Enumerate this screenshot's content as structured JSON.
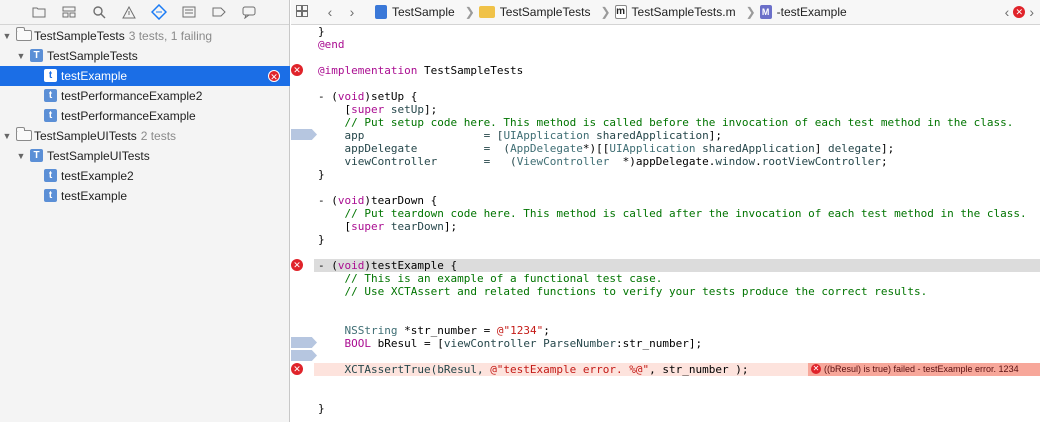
{
  "navigator": {
    "toolbar_icons": [
      "folder-icon",
      "hierarchy-icon",
      "search-icon",
      "warning-icon",
      "test-diamond-icon",
      "breakpoint-icon",
      "list-icon",
      "comment-icon"
    ],
    "items": [
      {
        "label": "TestSampleTests",
        "sub": "3 tests, 1 failing"
      },
      {
        "label": "TestSampleTests"
      },
      {
        "label": "testExample"
      },
      {
        "label": "testPerformanceExample2"
      },
      {
        "label": "testPerformanceExample"
      },
      {
        "label": "TestSampleUITests",
        "sub": "2 tests"
      },
      {
        "label": "TestSampleUITests"
      },
      {
        "label": "testExample2"
      },
      {
        "label": "testExample"
      }
    ],
    "t_glyph": "T",
    "t_small_glyph": "t",
    "error_glyph": "✕"
  },
  "jumpbar": {
    "project": "TestSample",
    "group": "TestSampleTests",
    "file": "TestSampleTests.m",
    "m_glyph": "m",
    "M_glyph": "M",
    "method": "-testExample"
  },
  "code": {
    "l1": "}",
    "l2": "@end",
    "l3_kw": "@implementation",
    "l3_name": " TestSampleTests",
    "l4_a": "- (",
    "l4_kw": "void",
    "l4_b": ")setUp {",
    "l5_a": "    [",
    "l5_kw": "super",
    "l5_m": " setUp",
    "l5_b": "];",
    "l6": "    // Put setup code here. This method is called before the invocation of each test method in the class.",
    "l7_a": "    app                  = [",
    "l7_cls": "UIApplication",
    "l7_m": " sharedApplication",
    "l7_b": "];",
    "l8_a": "    appDelegate          =  (",
    "l8_cls": "AppDelegate",
    "l8_b": "*)[[",
    "l8_cls2": "UIApplication",
    "l8_m": " sharedApplication",
    "l8_c": "] ",
    "l8_m2": "delegate",
    "l8_d": "];",
    "l9_a": "    viewController       =   (",
    "l9_cls": "ViewController",
    "l9_b": "  *)appDelegate.",
    "l9_m": "window",
    "l9_c": ".",
    "l9_m2": "rootViewController",
    "l9_d": ";",
    "l10": "}",
    "l11_a": "- (",
    "l11_kw": "void",
    "l11_b": ")tearDown {",
    "l12": "    // Put teardown code here. This method is called after the invocation of each test method in the class.",
    "l13_a": "    [",
    "l13_kw": "super",
    "l13_m": " tearDown",
    "l13_b": "];",
    "l14": "}",
    "l15_a": "- (",
    "l15_kw": "void",
    "l15_b": ")testExample {",
    "l16": "    // This is an example of a functional test case.",
    "l17": "    // Use XCTAssert and related functions to verify your tests produce the correct results.",
    "l18_cls": "    NSString",
    "l18_a": " *str_number = ",
    "l18_st": "@\"1234\"",
    "l18_b": ";",
    "l19_kw": "    BOOL",
    "l19_a": " bResul = [",
    "l19_m": "viewController",
    "l19_m2": " ParseNumber",
    "l19_b": ":str_number];",
    "l20_a": "    XCTAssertTrue(bResul, ",
    "l20_st": "@\"testExample error. %@\"",
    "l20_b": ", str_number );",
    "l21": "}",
    "inline_error": "((bResul) is true) failed - testExample error. 1234"
  }
}
